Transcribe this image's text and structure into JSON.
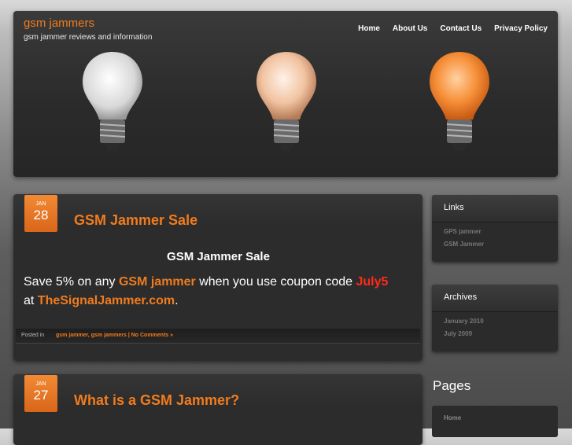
{
  "header": {
    "site_title": "gsm jammers",
    "site_description": "gsm jammer reviews and information",
    "nav": [
      "Home",
      "About Us",
      "Contact Us",
      "Privacy Policy"
    ],
    "bulbs": [
      {
        "name": "white-bulb",
        "color": "#f4f4f4"
      },
      {
        "name": "peach-bulb",
        "color": "#f3c6a6"
      },
      {
        "name": "orange-bulb",
        "color": "#f58a2e"
      }
    ]
  },
  "posts": [
    {
      "month": "JAN",
      "day": "28",
      "title": "GSM Jammer Sale",
      "heading": "GSM Jammer Sale",
      "body": {
        "t1": "Save 5% on any ",
        "link1": "GSM jammer",
        "t2": " when you use coupon code ",
        "code": "July5",
        "t3": "at ",
        "link2": "TheSignalJammer.com",
        "t4": "."
      },
      "posted_in": "Posted in",
      "tags": "gsm jammer, gsm jammers | No Comments »"
    },
    {
      "month": "JAN",
      "day": "27",
      "title": "What is a GSM Jammer?"
    }
  ],
  "sidebar": {
    "links": {
      "title": "Links",
      "items": [
        "GPS jammer",
        "GSM Jammer"
      ]
    },
    "archives": {
      "title": "Archives",
      "items": [
        "January 2010",
        "July 2009"
      ]
    },
    "pages": {
      "title": "Pages",
      "items": [
        "Home"
      ]
    }
  },
  "colors": {
    "accent": "#f07c1f",
    "coupon": "#ff2a1a"
  }
}
